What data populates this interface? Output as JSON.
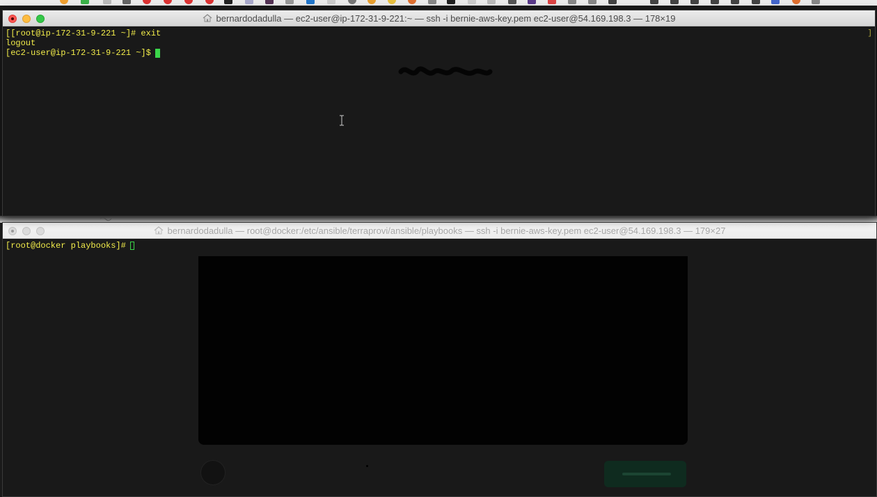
{
  "top_window": {
    "title": "bernardodadulla — ec2-user@ip-172-31-9-221:~ — ssh -i bernie-aws-key.pem ec2-user@54.169.198.3 — 178×19",
    "lines": [
      "[[root@ip-172-31-9-221 ~]# exit",
      "logout",
      "[ec2-user@ip-172-31-9-221 ~]$"
    ],
    "scroll_marker": "]"
  },
  "bottom_window": {
    "title": "bernardodadulla — root@docker:/etc/ansible/terraprovi/ansible/playbooks — ssh -i bernie-aws-key.pem ec2-user@54.169.198.3 — 179×27",
    "lines": [
      "[root@docker playbooks]#"
    ]
  },
  "icons": {
    "home": "home-icon",
    "close": "close-icon",
    "minimize": "minimize-icon",
    "zoom": "zoom-icon",
    "text_cursor": "ibeam-cursor-icon"
  },
  "colors": {
    "terminal_bg": "#191919",
    "prompt_text": "#f2ec4a",
    "cursor": "#3bd64a"
  }
}
